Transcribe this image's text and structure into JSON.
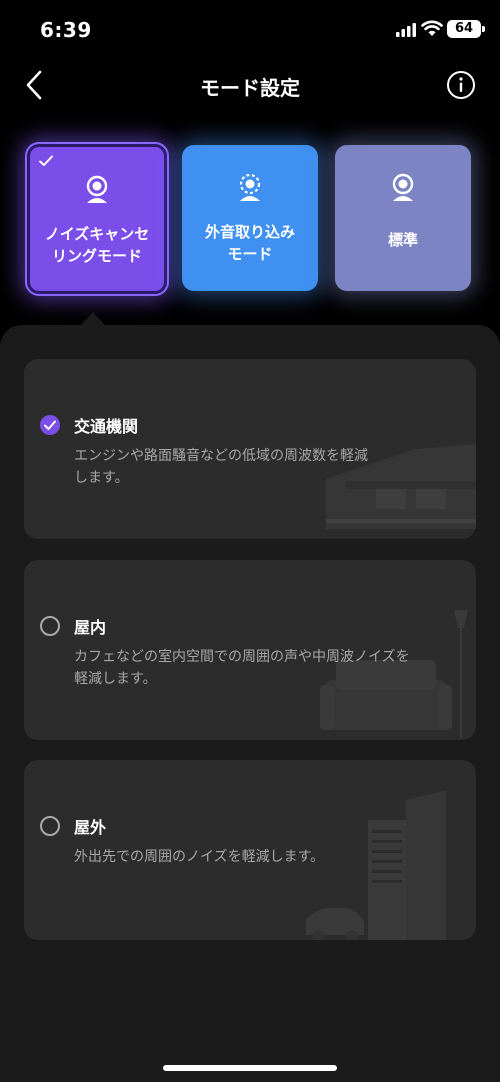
{
  "status_bar": {
    "time": "6:39",
    "battery": "64"
  },
  "header": {
    "title": "モード設定",
    "back_icon": "chevron-left-icon",
    "info_icon": "info-icon"
  },
  "modes": [
    {
      "label_line1": "ノイズキャンセ",
      "label_line2": "リングモード",
      "selected": true,
      "color": "#7b4eea",
      "icon": "person-icon"
    },
    {
      "label_line1": "外音取り込み",
      "label_line2": "モード",
      "selected": false,
      "color": "#3f90f0",
      "icon": "person-ambient-icon"
    },
    {
      "label_line1": "標準",
      "label_line2": "",
      "selected": false,
      "color": "#7d84c4",
      "icon": "person-icon"
    }
  ],
  "options": [
    {
      "title": "交通機関",
      "desc_line1": "エンジンや路面騒音などの低域の周波数を軽減",
      "desc_line2": "します。",
      "selected": true,
      "illustration": "train-icon"
    },
    {
      "title": "屋内",
      "desc_line1": "カフェなどの室内空間での周囲の声や中周波ノイズを",
      "desc_line2": "軽減します。",
      "selected": false,
      "illustration": "sofa-lamp-icon"
    },
    {
      "title": "屋外",
      "desc_line1": "外出先での周囲のノイズを軽減します。",
      "desc_line2": "",
      "selected": false,
      "illustration": "city-car-icon"
    }
  ],
  "colors": {
    "accent": "#7b4eea",
    "card_bg": "#2c2c2c",
    "panel_bg": "#1b1b1b"
  }
}
